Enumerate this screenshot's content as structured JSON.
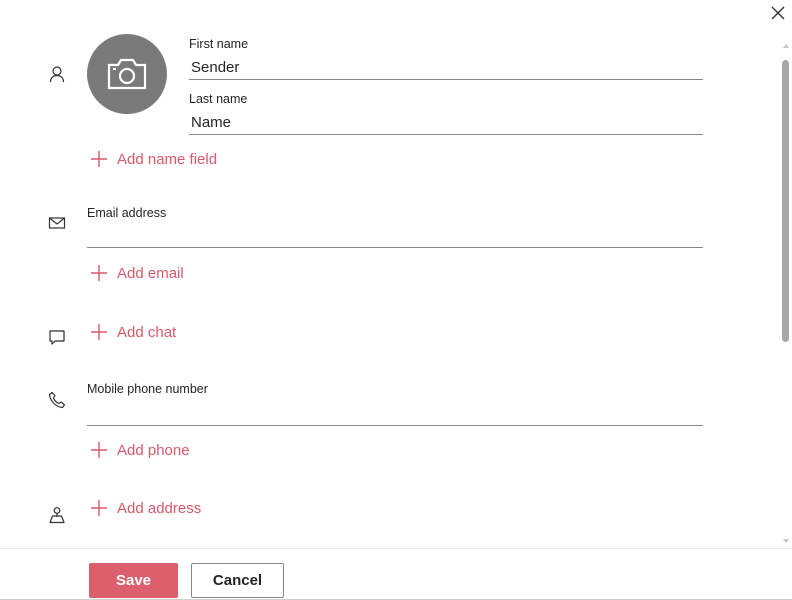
{
  "dialog": {
    "close_icon": "close-icon"
  },
  "photo": {
    "icon": "camera-icon",
    "color": "#7a7a7a"
  },
  "name": {
    "first_label": "First name",
    "first_value": "Sender",
    "last_label": "Last name",
    "last_value": "Name",
    "add_label": "Add name field"
  },
  "email": {
    "label": "Email address",
    "value": "",
    "add_label": "Add email"
  },
  "chat": {
    "add_label": "Add chat"
  },
  "phone": {
    "label": "Mobile phone number",
    "value": "",
    "add_label": "Add phone"
  },
  "address": {
    "add_label": "Add address"
  },
  "footer": {
    "save_label": "Save",
    "cancel_label": "Cancel"
  },
  "colors": {
    "accent": "#d9596a",
    "save_bg": "#dc5f6d"
  }
}
